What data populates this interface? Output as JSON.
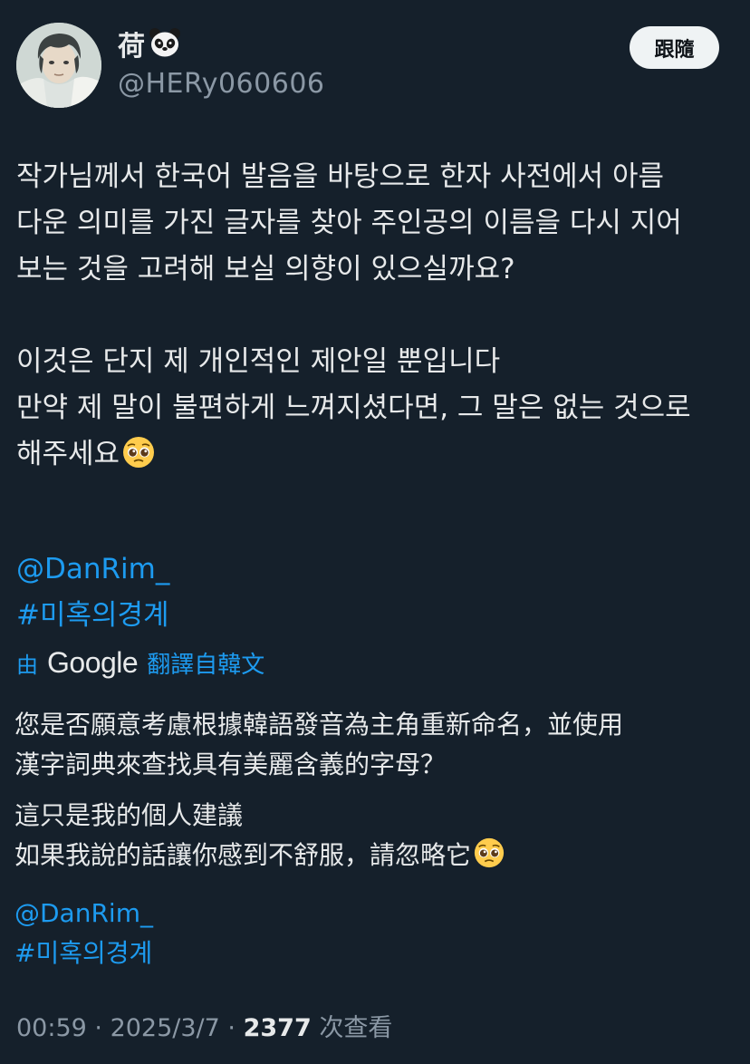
{
  "author": {
    "display_name": "荷",
    "display_emoji": "panda-face-emoji",
    "handle": "@HERy060606",
    "follow_label": "跟隨"
  },
  "tweet": {
    "para1": [
      "작가님께서 한국어 발음을 바탕으로 한자 사전에서 아름",
      "다운 의미를 가진 글자를 찾아 주인공의 이름을 다시 지어",
      "보는 것을 고려해 보실 의향이 있으실까요?"
    ],
    "para2": [
      "이것은 단지 제 개인적인 제안일 뿐입니다",
      "만약 제 말이 불편하게 느껴지셨다면, 그 말은 없는 것으로",
      "해주세요"
    ],
    "mention": "@DanRim_",
    "hashtag": " #미혹의경계"
  },
  "translation": {
    "by": "由",
    "provider": "Google",
    "action": "翻譯自韓文",
    "para1": [
      "您是否願意考慮根據韓語發音為主角重新命名，並使用",
      "漢字詞典來查找具有美麗含義的字母？"
    ],
    "para2": [
      "這只是我的個人建議",
      "如果我說的話讓你感到不舒服，請忽略它"
    ],
    "mention": "@DanRim_",
    "hashtag": " #미혹의경계"
  },
  "footer": {
    "time": "00:59",
    "sep1": " · ",
    "date": "2025/3/7",
    "sep2": " · ",
    "views_count": "2377",
    "views_label": " 次查看"
  },
  "colors": {
    "background": "#15202b",
    "text": "#e7e9ea",
    "secondary": "#8b98a5",
    "link": "#1d9bf0",
    "button_bg": "#eff3f4"
  },
  "icons": {
    "pleading_emoji": "pleading-face-emoji",
    "panda_emoji": "panda-face-emoji"
  }
}
